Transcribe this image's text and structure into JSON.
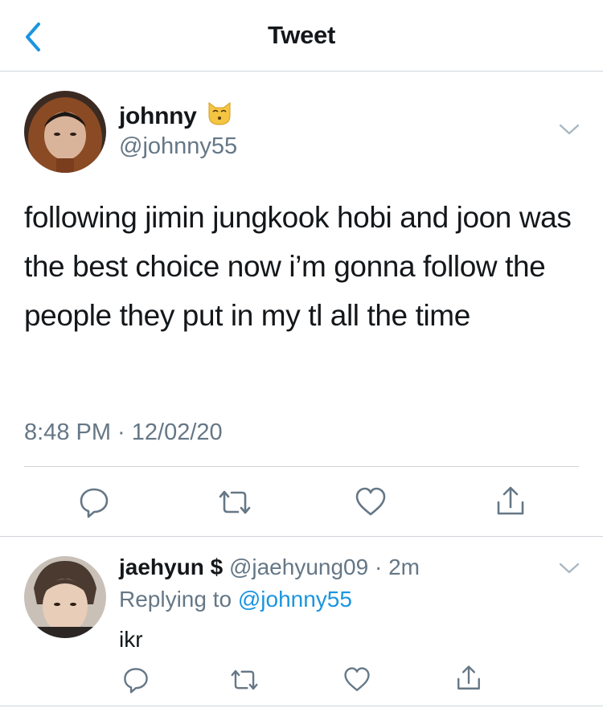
{
  "header": {
    "title": "Tweet"
  },
  "tweet": {
    "author_name": "johnny",
    "author_handle": "@johnny55",
    "text": "following jimin jungkook hobi and joon was the best choice now i’m gonna follow the people they put in my tl all the time",
    "timestamp": "8:48 PM · 12/02/20"
  },
  "reply": {
    "author_name": "jaehyun $",
    "author_handle": "@jaehyung09",
    "age": "· 2m",
    "replying_prefix": "Replying to",
    "replying_to": "@johnny55",
    "text": "ikr"
  },
  "colors": {
    "accent": "#1b95e0",
    "muted": "#657786",
    "divider": "#d0d5d9",
    "text": "#14171a"
  },
  "icons": [
    "back-chevron-icon",
    "kissing-cat-emoji-icon",
    "chevron-down-icon",
    "reply-icon",
    "retweet-icon",
    "like-icon",
    "share-icon"
  ]
}
